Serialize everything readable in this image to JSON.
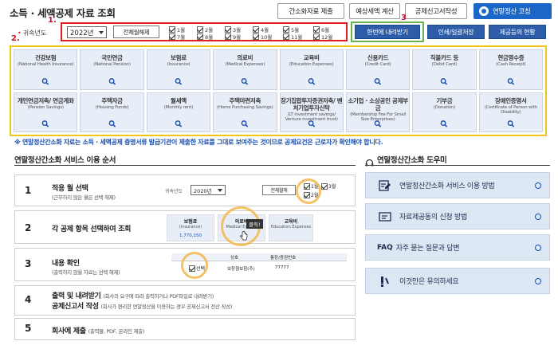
{
  "header": {
    "title": "소득 · 세액공제 자료 조회",
    "buttons": [
      "간소화자료 제출",
      "예상세액 계산",
      "공제신고서작성"
    ],
    "blue_button": "연말정산 코칭",
    "annotations": [
      "1.",
      "2.",
      "3"
    ]
  },
  "filter": {
    "required_mark": "•",
    "year_label": "귀속년도",
    "year_value": "2022년",
    "select_all": "전체월해제",
    "months": [
      "1월",
      "2월",
      "3월",
      "4월",
      "5월",
      "6월",
      "7월",
      "8월",
      "9월",
      "10월",
      "11월",
      "12월"
    ],
    "buttons": [
      "한번에 내려받기",
      "인쇄/일괄저장",
      "제공등의 현황"
    ]
  },
  "categories": [
    {
      "ko": "건강보험",
      "en": "(National Health Insurance)"
    },
    {
      "ko": "국민연금",
      "en": "(National Pension)"
    },
    {
      "ko": "보험료",
      "en": "(Insurance)"
    },
    {
      "ko": "의료비",
      "en": "(Medical Expenses)"
    },
    {
      "ko": "교육비",
      "en": "(Education Expenses)"
    },
    {
      "ko": "신용카드",
      "en": "(Credit Card)"
    },
    {
      "ko": "직불카드 등",
      "en": "(Debit Card)"
    },
    {
      "ko": "현금영수증",
      "en": "(Cash Receipt)"
    },
    {
      "ko": "개인연금저축/ 연금계좌",
      "en": "(Pension Savings)"
    },
    {
      "ko": "주택자금",
      "en": "(Housing Funds)"
    },
    {
      "ko": "월세액",
      "en": "(Monthly rent)"
    },
    {
      "ko": "주택마련저축",
      "en": "(Home Purchasing Savings)"
    },
    {
      "ko": "장기집합투자증권저축/ 벤처기업투자신탁",
      "en": "(LT investment savings/ Venture investment trust)"
    },
    {
      "ko": "소기업 · 소상공인 공제부금",
      "en": "(Membership Fee For Small Size Enterprises)"
    },
    {
      "ko": "기부금",
      "en": "(Donation)"
    },
    {
      "ko": "장애인증명서",
      "en": "(Certificate of Person with Disability)"
    }
  ],
  "notice": "※ 연말정산간소화 자료는 소득 · 세액공제 증명서류 발급기관이 제출한 자료를 그대로 보여주는 것이므로 공제요건은 근로자가 확인해야 합니다.",
  "guide": {
    "title": "연말정산간소화 서비스 이용 순서",
    "steps": [
      {
        "num": "1",
        "title": "적용 월 선택",
        "sub": "(근무하지 않은 월은 선택 해제)"
      },
      {
        "num": "2",
        "title": "각 공제 항목 선택하여 조회",
        "sub": ""
      },
      {
        "num": "3",
        "title": "내용 확인",
        "sub": "(출력하지 않을 자료는 선택 해제)"
      },
      {
        "num": "4",
        "title": "출력 및 내려받기",
        "title2": "공제신고서 작성",
        "sub": "(회사의 요구에 따라 출력하거나 PDF파일로 내려받기)",
        "sub2": "(회사가 편리한 연말정산을 이용하는 경우 공제신고서 전산 작성)"
      },
      {
        "num": "5",
        "title": "회사에 제출",
        "sub": "(출력물, PDF, 온라인 제출)"
      }
    ],
    "mini": {
      "year_label": "귀속년도",
      "year_value": "2020년",
      "select_all": "전체월해",
      "m1": "1월",
      "m2": "2월",
      "m3": "3월",
      "c_ins": "보험료",
      "c_ins_en": "(Insurance)",
      "c_med": "의료비",
      "c_med_en": "Medical Expens",
      "c_edu": "교육비",
      "c_edu_en": "Education Expenses",
      "amount": "1,770,150",
      "click": "클릭!",
      "col_kind": "상호",
      "col_no": "통장/증권번호",
      "select": "선택",
      "row_name": "보장형보험(주)",
      "row_value": "77777"
    }
  },
  "help": {
    "title": "연말정산간소화 도우미",
    "items": [
      "연말정산간소화 서비스 이용 방법",
      "자료제공동의 신청 방법",
      "자주 묻는 질문과 답변",
      "이것만은 유의하세요"
    ],
    "faq_prefix": "FAQ"
  }
}
